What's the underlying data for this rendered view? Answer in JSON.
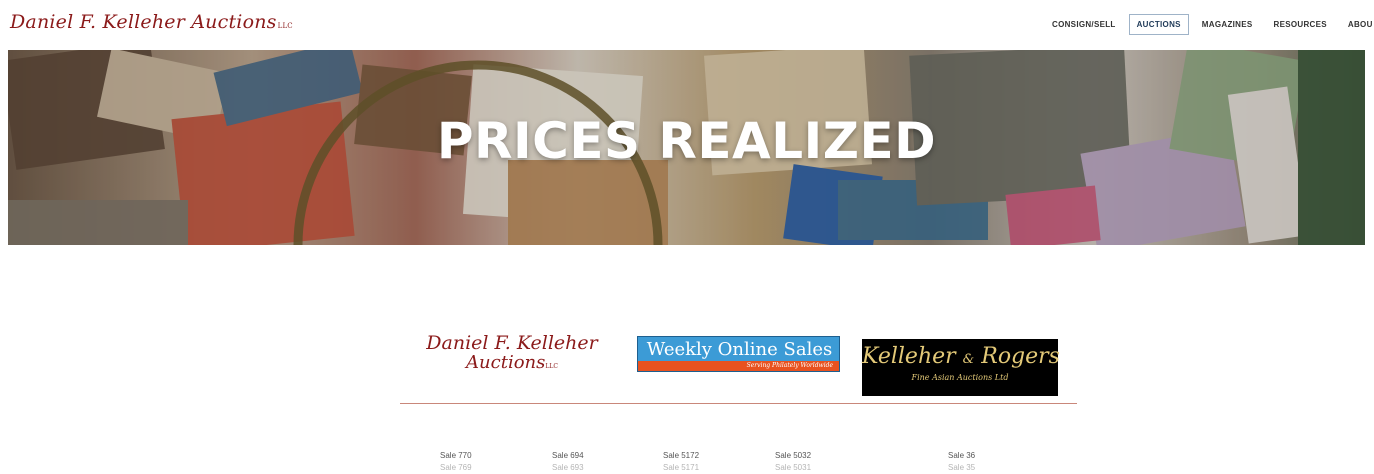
{
  "header": {
    "logo_text": "Daniel F. Kelleher Auctions",
    "logo_suffix": "LLC",
    "nav": [
      "CONSIGN/SELL",
      "AUCTIONS",
      "MAGAZINES",
      "RESOURCES",
      "ABOU"
    ],
    "active_nav": "AUCTIONS"
  },
  "hero": {
    "title": "PRICES REALIZED"
  },
  "brands": {
    "dfk_line1": "Daniel F. Kelleher",
    "dfk_line2": "Auctions",
    "dfk_suffix": "LLC",
    "wos_title": "Weekly Online Sales",
    "wos_tagline": "Serving Philately Worldwide",
    "kr_title_a": "Kelleher",
    "kr_amp": "&",
    "kr_title_b": "Rogers",
    "kr_sub": "Fine Asian Auctions",
    "kr_suffix": "Ltd"
  },
  "sales": {
    "col1": [
      "Sale 770",
      "Sale 769"
    ],
    "col2": [
      "Sale 694",
      "Sale 693"
    ],
    "col3": [
      "Sale 5172",
      "Sale 5171"
    ],
    "col4": [
      "Sale 5032",
      "Sale 5031"
    ],
    "col5": [
      "Sale 36",
      "Sale 35"
    ]
  },
  "colors": {
    "brand_red": "#8b1a1a",
    "wos_blue": "#3c9bd6",
    "wos_orange": "#e8521f",
    "kr_gold": "#e3c978",
    "divider": "#c9877a",
    "active_border": "#9fb3c8"
  }
}
